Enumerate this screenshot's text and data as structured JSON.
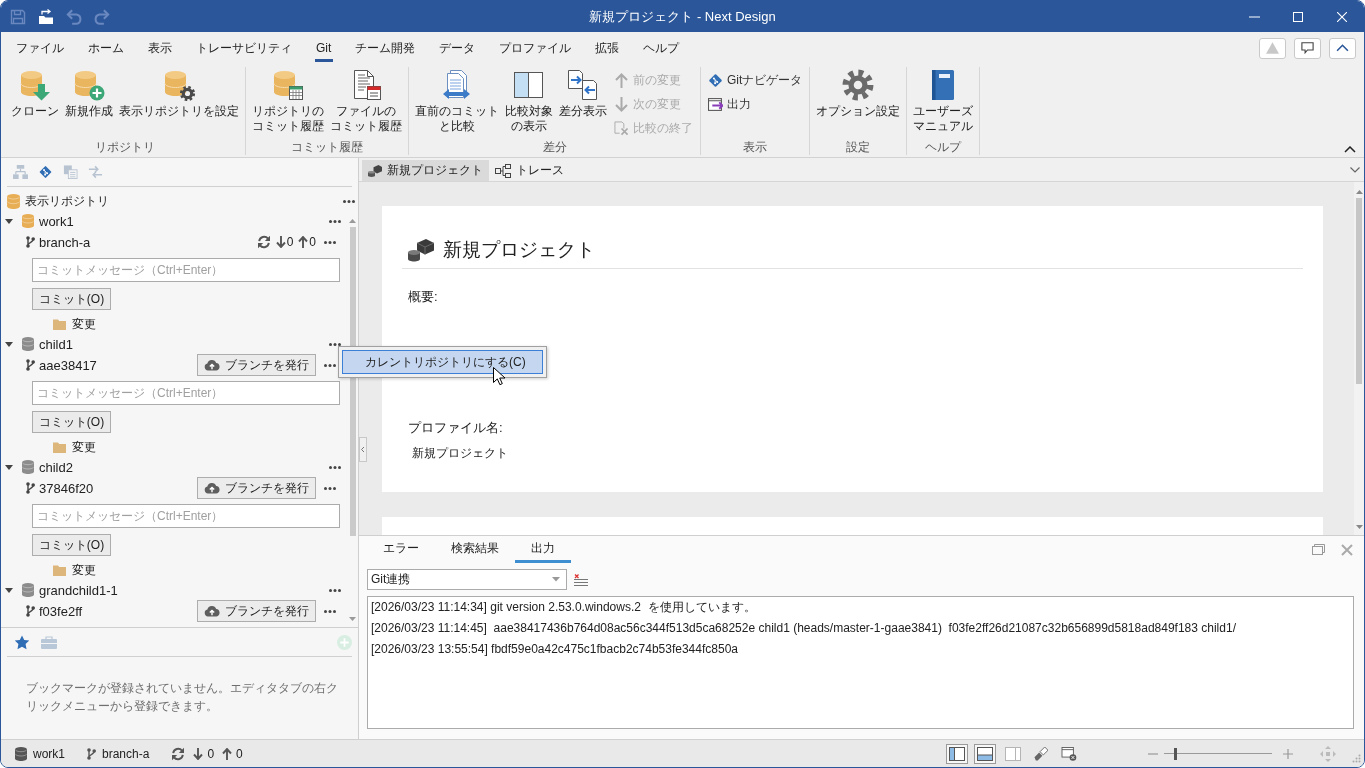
{
  "window": {
    "title": "新規プロジェクト - Next Design"
  },
  "quick_access": [
    {
      "disabled": true
    },
    {
      "disabled": false
    },
    {
      "disabled": true
    },
    {
      "disabled": true
    }
  ],
  "menu_tabs": [
    {
      "label": "ファイル",
      "selected": false
    },
    {
      "label": "ホーム",
      "selected": false
    },
    {
      "label": "表示",
      "selected": false
    },
    {
      "label": "トレーサビリティ",
      "selected": false
    },
    {
      "label": "Git",
      "selected": true
    },
    {
      "label": "チーム開発",
      "selected": false
    },
    {
      "label": "データ",
      "selected": false
    },
    {
      "label": "プロファイル",
      "selected": false
    },
    {
      "label": "拡張",
      "selected": false
    },
    {
      "label": "ヘルプ",
      "selected": false
    }
  ],
  "ribbon_corner_buttons": [
    {
      "disabled": true
    },
    {
      "disabled": false
    },
    {
      "disabled": false
    }
  ],
  "ribbon": {
    "groups": [
      {
        "label": "リポジトリ",
        "items": [
          {
            "kind": "large",
            "label": "クローン",
            "disabled": false
          },
          {
            "kind": "large",
            "label": "新規作成",
            "disabled": false
          },
          {
            "kind": "large",
            "label": "表示リポジトリを設定",
            "disabled": false
          }
        ]
      },
      {
        "label": "コミット履歴",
        "items": [
          {
            "kind": "large",
            "label": "リポジトリのコミット履歴",
            "disabled": false
          },
          {
            "kind": "large",
            "label": "ファイルのコミット履歴",
            "disabled": false
          }
        ]
      },
      {
        "label": "差分",
        "items": [
          {
            "kind": "large",
            "label": "直前のコミットと比較",
            "disabled": false
          },
          {
            "kind": "large",
            "label": "比較対象の表示",
            "disabled": false
          },
          {
            "kind": "large",
            "label": "差分表示",
            "disabled": false
          },
          {
            "kind": "small",
            "label": "前の変更",
            "disabled": true
          },
          {
            "kind": "small",
            "label": "次の変更",
            "disabled": true
          },
          {
            "kind": "small",
            "label": "比較の終了",
            "disabled": true
          }
        ]
      },
      {
        "label": "表示",
        "items": [
          {
            "kind": "small",
            "label": "Gitナビゲータ",
            "disabled": false
          },
          {
            "kind": "small",
            "label": "出力",
            "disabled": false
          }
        ]
      },
      {
        "label": "設定",
        "items": [
          {
            "kind": "large",
            "label": "オプション設定",
            "disabled": false
          }
        ]
      },
      {
        "label": "ヘルプ",
        "items": [
          {
            "kind": "large",
            "label": "ユーザーズマニュアル",
            "disabled": false
          }
        ]
      }
    ]
  },
  "navigator": {
    "tools": [
      {
        "selected": false
      },
      {
        "selected": true
      },
      {
        "selected": false
      },
      {
        "selected": false
      }
    ],
    "header": "表示リポジトリ",
    "repositories": [
      {
        "name": "work1",
        "current": true,
        "expanded": true,
        "branch": "branch-a",
        "sync": {
          "behind": "0",
          "ahead": "0"
        },
        "commit": {
          "placeholder": "コミットメッセージ（Ctrl+Enter）",
          "button": "コミット(O)"
        },
        "changes": "変更"
      },
      {
        "name": "child1",
        "current": false,
        "expanded": true,
        "branch": "aae38417",
        "publish_button": "ブランチを発行",
        "commit": {
          "placeholder": "コミットメッセージ（Ctrl+Enter）",
          "button": "コミット(O)"
        },
        "changes": "変更"
      },
      {
        "name": "child2",
        "current": false,
        "expanded": true,
        "branch": "37846f20",
        "publish_button": "ブランチを発行",
        "commit": {
          "placeholder": "コミットメッセージ（Ctrl+Enter）",
          "button": "コミット(O)"
        },
        "changes": "変更"
      },
      {
        "name": "grandchild1-1",
        "current": false,
        "expanded": true,
        "branch": "f03fe2ff",
        "publish_button": "ブランチを発行"
      }
    ]
  },
  "context_menu": {
    "items": [
      {
        "label": "カレントリポジトリにする(C)",
        "selected": true
      }
    ]
  },
  "bookmarks": {
    "tabs": [
      {
        "selected": true
      },
      {
        "selected": false
      }
    ],
    "add_button": {
      "disabled": true
    },
    "message": "ブックマークが登録されていません。エディタタブの右クリックメニューから登録できます。"
  },
  "editor": {
    "tabs": [
      {
        "label": "新規プロジェクト",
        "selected": true
      },
      {
        "label": "トレース",
        "selected": false
      }
    ],
    "document": {
      "title": "新規プロジェクト",
      "fields": [
        {
          "kind": "multiline",
          "label": "概要:"
        },
        {
          "kind": "line",
          "label": "プロファイル名:",
          "value": "新規プロジェクト"
        }
      ]
    }
  },
  "output_panel": {
    "tabs": [
      {
        "label": "エラー",
        "selected": false
      },
      {
        "label": "検索結果",
        "selected": false
      },
      {
        "label": "出力",
        "selected": true
      }
    ],
    "source": "Git連携",
    "lines": [
      "[2026/03/23 11:14:34] git version 2.53.0.windows.2  を使用しています。",
      "[2026/03/23 11:14:45]  aae38417436b764d08ac56c344f513d5ca68252e child1 (heads/master-1-gaae3841)  f03fe2ff26d21087c32b656899d5818ad849f183 child1/",
      "[2026/03/23 13:55:54] fbdf59e0a42c475c1fbacb2c74b53fe344fc850a"
    ]
  },
  "status_bar": {
    "repository": "work1",
    "branch": "branch-a",
    "behind": "0",
    "ahead": "0",
    "views": [
      {
        "selected": true
      },
      {
        "selected": true
      },
      {
        "selected": false
      },
      {
        "selected": false
      },
      {
        "selected": false
      }
    ],
    "zoom": {
      "level": 0.1
    }
  }
}
